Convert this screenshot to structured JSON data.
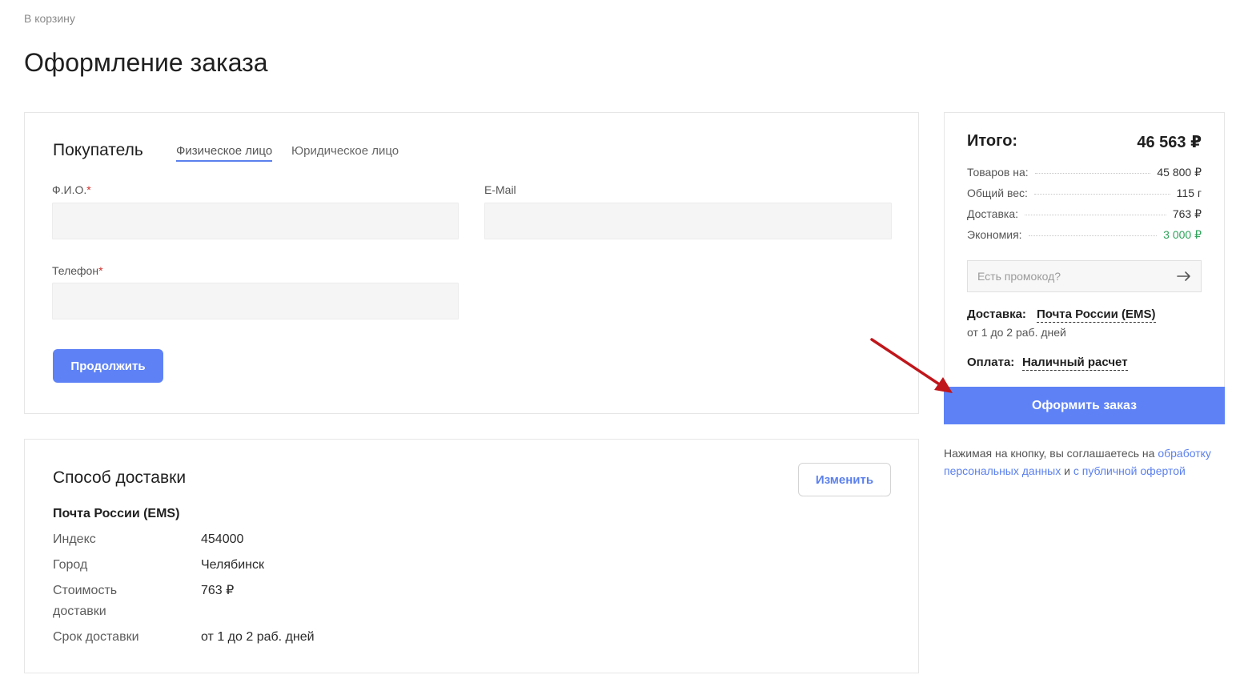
{
  "breadcrumb": {
    "back_label": "В корзину"
  },
  "page": {
    "title": "Оформление заказа"
  },
  "buyer": {
    "title": "Покупатель",
    "tabs": [
      {
        "label": "Физическое лицо",
        "active": true
      },
      {
        "label": "Юридическое лицо",
        "active": false
      }
    ],
    "fields": {
      "name_label": "Ф.И.О.",
      "email_label": "E-Mail",
      "phone_label": "Телефон",
      "required_mark": "*"
    },
    "continue_label": "Продолжить"
  },
  "delivery": {
    "title": "Способ доставки",
    "change_label": "Изменить",
    "method": "Почта России (EMS)",
    "rows": [
      {
        "key": "Индекс",
        "value": "454000"
      },
      {
        "key": "Город",
        "value": "Челябинск"
      },
      {
        "key": "Стоимость доставки",
        "value": "763 ₽"
      },
      {
        "key": "Срок доставки",
        "value": "от 1 до 2 раб. дней"
      }
    ]
  },
  "summary": {
    "total_label": "Итого:",
    "total_value": "46 563 ₽",
    "rows": [
      {
        "label": "Товаров на:",
        "value": "45 800 ₽"
      },
      {
        "label": "Общий вес:",
        "value": "115 г"
      },
      {
        "label": "Доставка:",
        "value": "763 ₽"
      },
      {
        "label": "Экономия:",
        "value": "3 000 ₽",
        "highlight": "green"
      }
    ],
    "promo_placeholder": "Есть промокод?",
    "delivery_label": "Доставка:",
    "delivery_value": "Почта России (EMS)",
    "delivery_term": "от 1 до 2 раб. дней",
    "payment_label": "Оплата:",
    "payment_value": "Наличный расчет"
  },
  "checkout": {
    "button_label": "Оформить заказ",
    "consent_prefix": "Нажимая на кнопку, вы соглашаетесь на",
    "consent_link1": "обработку персональных данных",
    "consent_and": "и",
    "consent_link2": "с публичной офертой"
  },
  "colors": {
    "accent": "#5e82f6",
    "savings": "#2ea35a",
    "annotation_arrow": "#c0161b"
  },
  "icons": {
    "promo_submit": "arrow-right-icon",
    "annotation": "red-arrow-annotation"
  }
}
